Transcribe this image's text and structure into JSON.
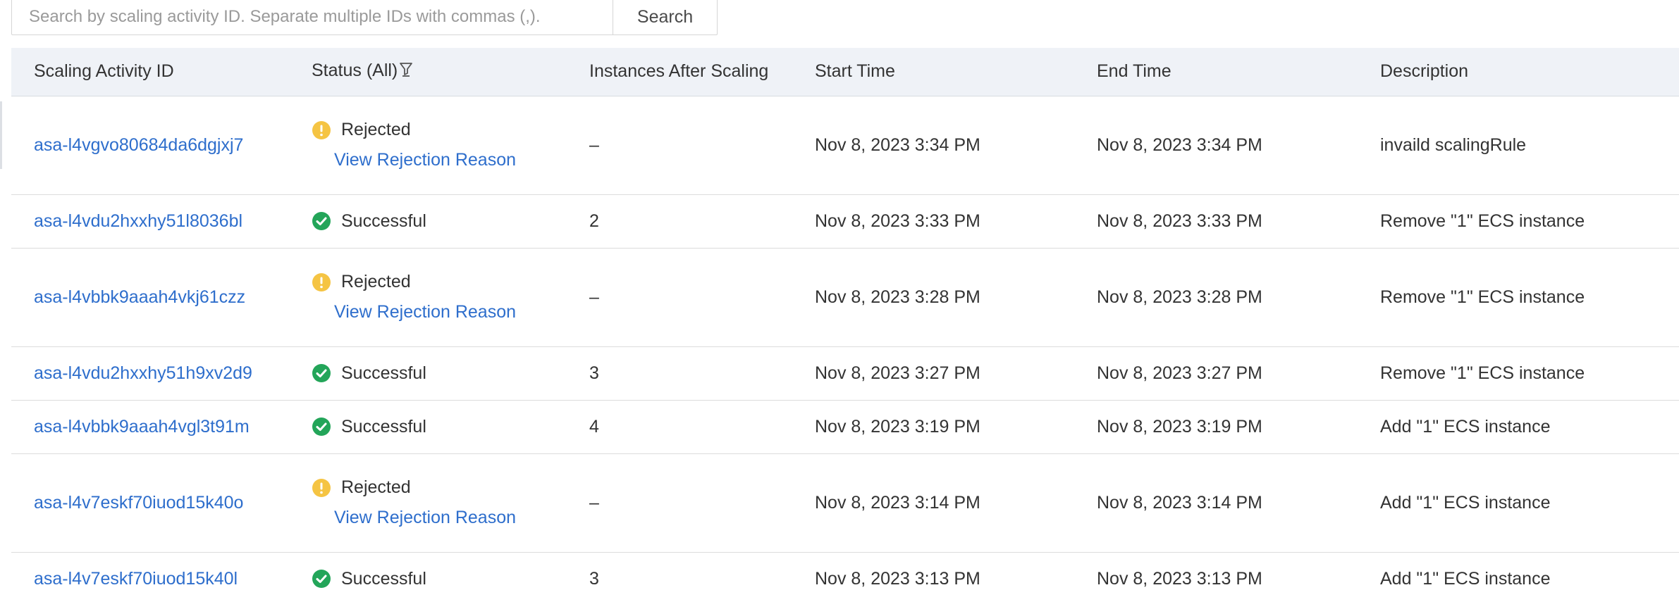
{
  "search": {
    "placeholder": "Search by scaling activity ID. Separate multiple IDs with commas (,).",
    "value": "",
    "button_label": "Search"
  },
  "table": {
    "columns": {
      "id": "Scaling Activity ID",
      "status": "Status (All)",
      "instances": "Instances After Scaling",
      "start": "Start Time",
      "end": "End Time",
      "description": "Description"
    },
    "status_filter_icon": "funnel-icon",
    "rows": [
      {
        "id": "asa-l4vgvo80684da6dgjxj7",
        "status": "Rejected",
        "status_icon": "warning-icon",
        "reason_link": "View Rejection Reason",
        "instances": "–",
        "start": "Nov 8, 2023 3:34 PM",
        "end": "Nov 8, 2023 3:34 PM",
        "description": "invaild scalingRule"
      },
      {
        "id": "asa-l4vdu2hxxhy51l8036bl",
        "status": "Successful",
        "status_icon": "check-circle-icon",
        "reason_link": "",
        "instances": "2",
        "start": "Nov 8, 2023 3:33 PM",
        "end": "Nov 8, 2023 3:33 PM",
        "description": "Remove \"1\" ECS instance"
      },
      {
        "id": "asa-l4vbbk9aaah4vkj61czz",
        "status": "Rejected",
        "status_icon": "warning-icon",
        "reason_link": "View Rejection Reason",
        "instances": "–",
        "start": "Nov 8, 2023 3:28 PM",
        "end": "Nov 8, 2023 3:28 PM",
        "description": "Remove \"1\" ECS instance"
      },
      {
        "id": "asa-l4vdu2hxxhy51h9xv2d9",
        "status": "Successful",
        "status_icon": "check-circle-icon",
        "reason_link": "",
        "instances": "3",
        "start": "Nov 8, 2023 3:27 PM",
        "end": "Nov 8, 2023 3:27 PM",
        "description": "Remove \"1\" ECS instance"
      },
      {
        "id": "asa-l4vbbk9aaah4vgl3t91m",
        "status": "Successful",
        "status_icon": "check-circle-icon",
        "reason_link": "",
        "instances": "4",
        "start": "Nov 8, 2023 3:19 PM",
        "end": "Nov 8, 2023 3:19 PM",
        "description": "Add \"1\" ECS instance"
      },
      {
        "id": "asa-l4v7eskf70iuod15k40o",
        "status": "Rejected",
        "status_icon": "warning-icon",
        "reason_link": "View Rejection Reason",
        "instances": "–",
        "start": "Nov 8, 2023 3:14 PM",
        "end": "Nov 8, 2023 3:14 PM",
        "description": "Add \"1\" ECS instance"
      },
      {
        "id": "asa-l4v7eskf70iuod15k40l",
        "status": "Successful",
        "status_icon": "check-circle-icon",
        "reason_link": "",
        "instances": "3",
        "start": "Nov 8, 2023 3:13 PM",
        "end": "Nov 8, 2023 3:13 PM",
        "description": "Add \"1\" ECS instance"
      }
    ]
  },
  "colors": {
    "link": "#2e6ecc",
    "success": "#23a559",
    "warning": "#f5c443",
    "header_bg": "#eff2f7"
  }
}
